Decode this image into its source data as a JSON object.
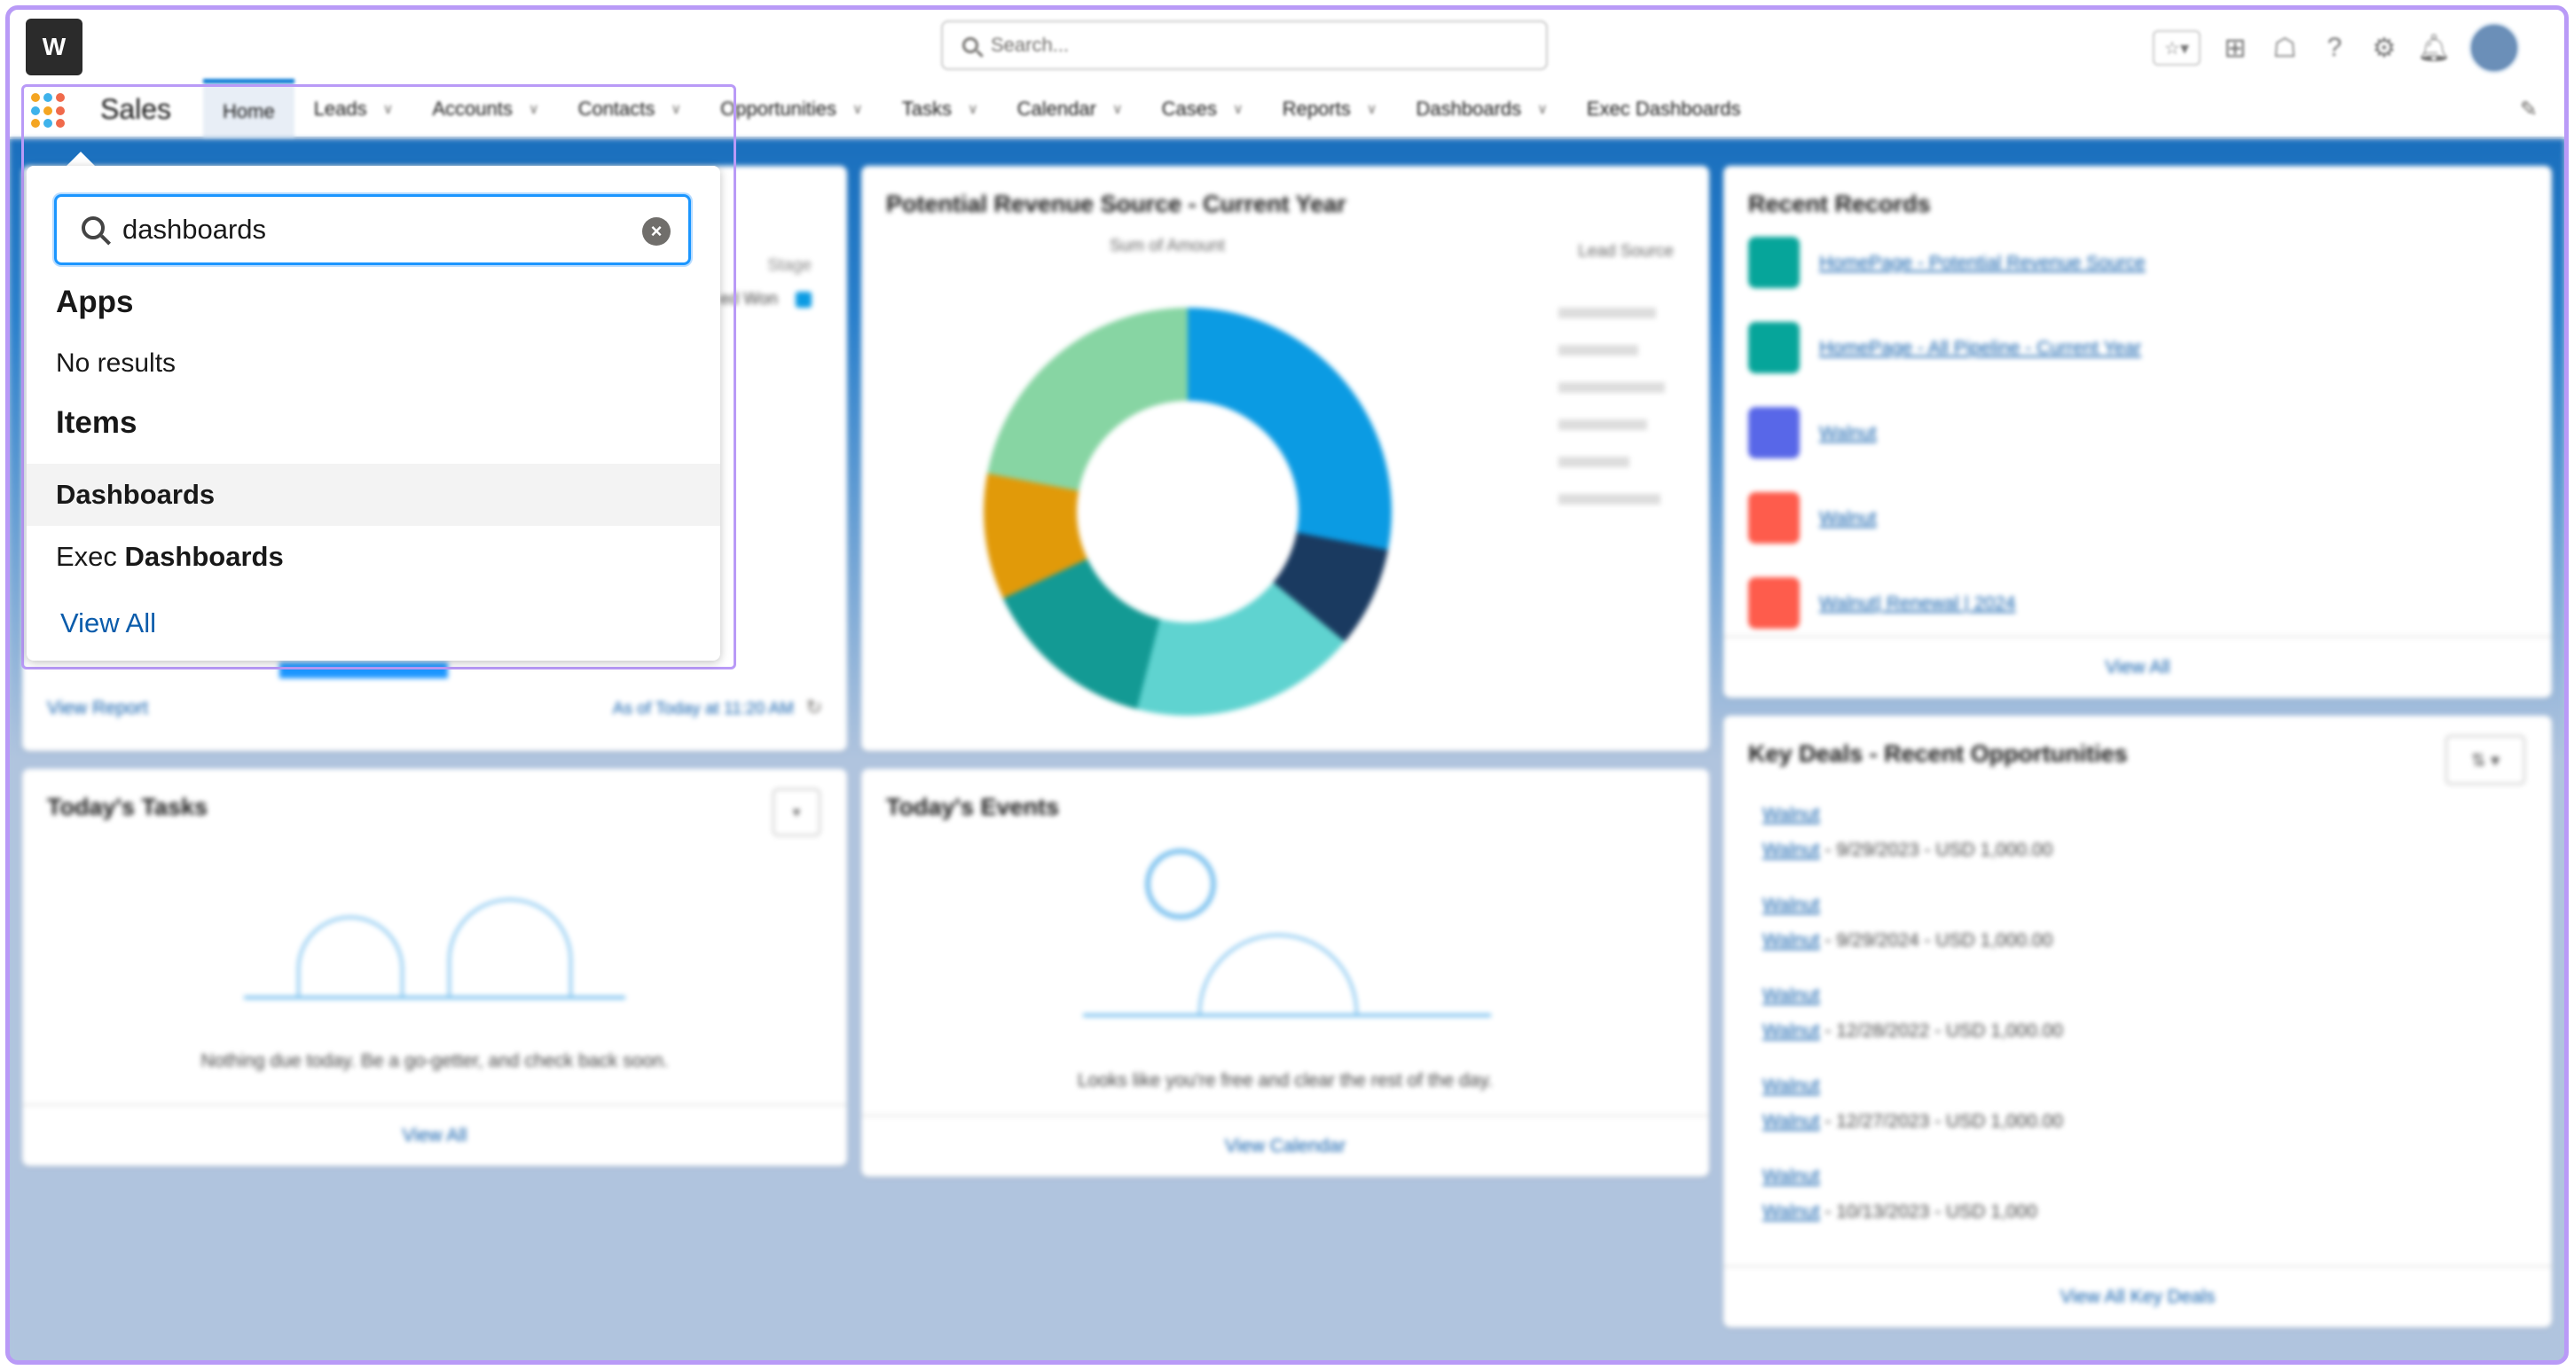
{
  "header": {
    "logo_letter": "W",
    "search_placeholder": "Search..."
  },
  "nav": {
    "app_name": "Sales",
    "items": [
      {
        "label": "Home",
        "chevron": false,
        "active": true
      },
      {
        "label": "Leads",
        "chevron": true
      },
      {
        "label": "Accounts",
        "chevron": true
      },
      {
        "label": "Contacts",
        "chevron": true
      },
      {
        "label": "Opportunities",
        "chevron": true
      },
      {
        "label": "Tasks",
        "chevron": true
      },
      {
        "label": "Calendar",
        "chevron": true
      },
      {
        "label": "Cases",
        "chevron": true
      },
      {
        "label": "Reports",
        "chevron": true
      },
      {
        "label": "Dashboards",
        "chevron": true
      },
      {
        "label": "Exec Dashboards",
        "chevron": false
      }
    ]
  },
  "search_dropdown": {
    "query": "dashboards",
    "apps_heading": "Apps",
    "apps_empty": "No results",
    "items_heading": "Items",
    "items": [
      {
        "prefix": "",
        "match": "Dashboards"
      },
      {
        "prefix": "Exec ",
        "match": "Dashboards"
      }
    ],
    "view_all": "View All"
  },
  "cards": {
    "left_top": {
      "stage_label": "Stage",
      "legend_item": "ed Won",
      "view_report": "View Report",
      "as_of": "As of Today at 11:20 AM"
    },
    "revenue": {
      "title": "Potential Revenue Source - Current Year",
      "x_label": "Sum of Amount",
      "legend_title": "Lead Source"
    },
    "recent_records": {
      "title": "Recent Records",
      "items": [
        {
          "label": "HomePage - Potential Revenue Source",
          "color": "#06a59a"
        },
        {
          "label": "HomePage - All Pipeline - Current Year",
          "color": "#06a59a"
        },
        {
          "label": "Walnut",
          "color": "#5867e8"
        },
        {
          "label": "Walnut",
          "color": "#fe5c4c"
        },
        {
          "label": "Walnut| Renewal | 2024",
          "color": "#fe5c4c"
        }
      ],
      "footer": "View All"
    },
    "tasks": {
      "title": "Today's Tasks",
      "empty_text": "Nothing due today. Be a go-getter, and check back soon.",
      "footer": "View All"
    },
    "events": {
      "title": "Today's Events",
      "empty_text": "Looks like you're free and clear the rest of the day.",
      "footer": "View Calendar"
    },
    "key_deals": {
      "title": "Key Deals - Recent Opportunities",
      "deals": [
        {
          "name": "Walnut",
          "account": "Walnut",
          "detail": " - 9/29/2023 - USD 1,000.00"
        },
        {
          "name": "Walnut",
          "account": "Walnut",
          "detail": " - 9/29/2024 - USD 1,000.00"
        },
        {
          "name": "Walnut",
          "account": "Walnut",
          "detail": " - 12/28/2022 - USD 1,000.00"
        },
        {
          "name": "Walnut",
          "account": "Walnut",
          "detail": " - 12/27/2023 - USD 1,000.00"
        },
        {
          "name": "Walnut",
          "account": "Walnut",
          "detail": " - 10/13/2023 - USD 1,000"
        }
      ],
      "footer": "View All Key Deals"
    }
  },
  "colors": {
    "accent": "#0176d3",
    "highlight_outline": "#b99af7",
    "link": "#0b5cab"
  }
}
